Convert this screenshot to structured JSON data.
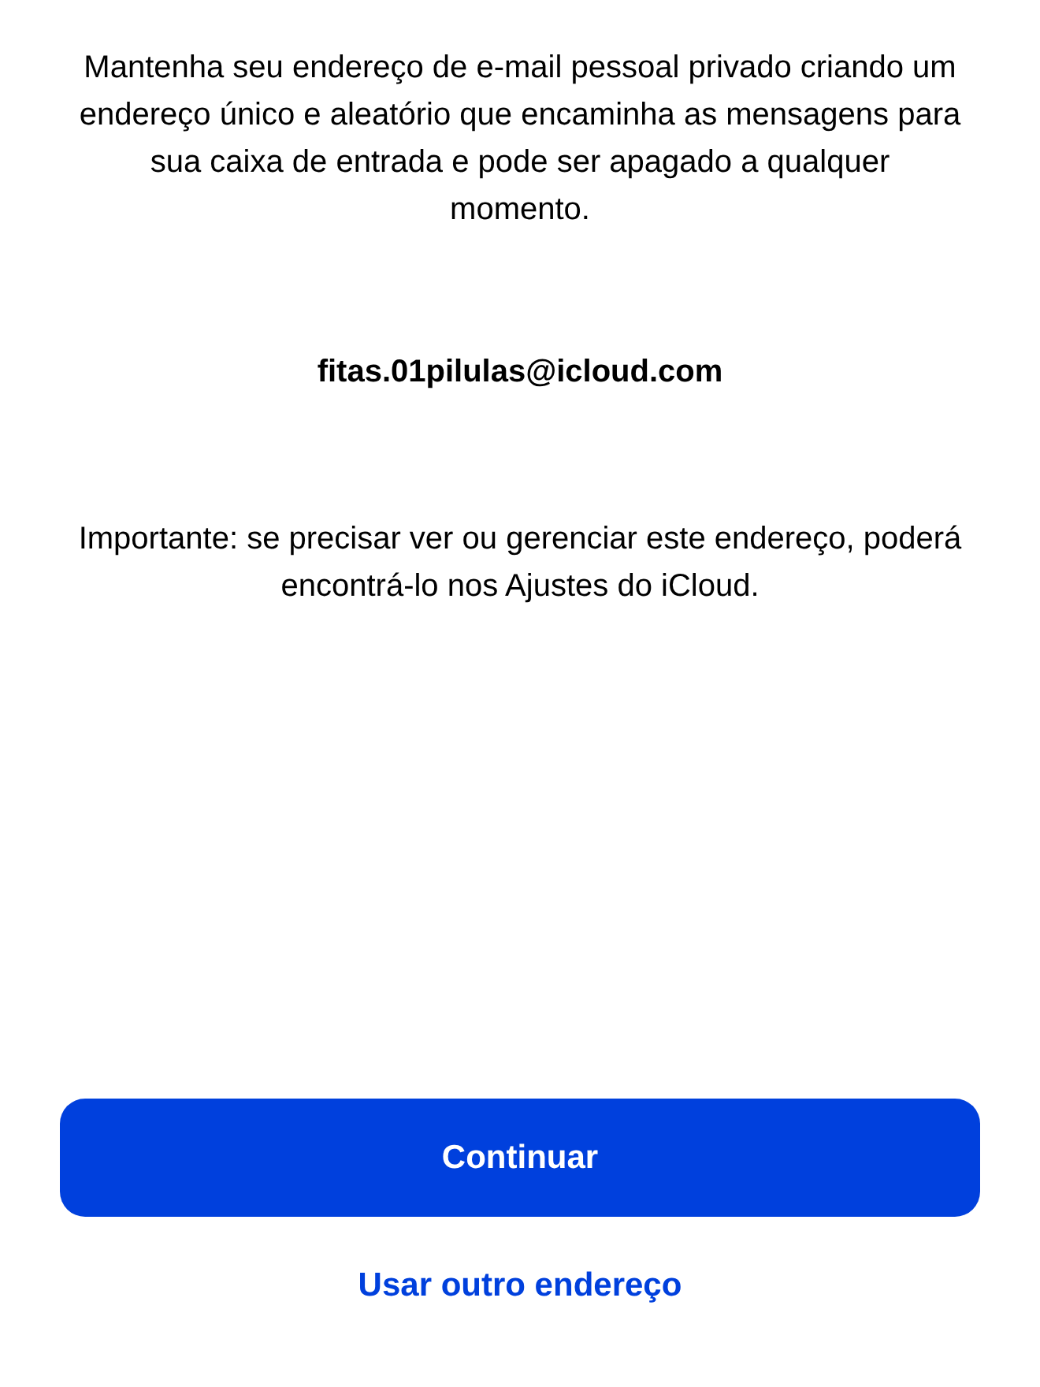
{
  "description": "Mantenha seu endereço de e-mail pessoal privado criando um endereço único e aleatório que encaminha as mensagens para sua caixa de entrada e pode ser apagado a qualquer momento.",
  "email": "fitas.01pilulas@icloud.com",
  "note": "Importante: se precisar ver ou gerenciar este endereço, poderá encontrá-lo nos Ajustes do iCloud.",
  "primary_button": "Continuar",
  "secondary_link": "Usar outro endereço"
}
